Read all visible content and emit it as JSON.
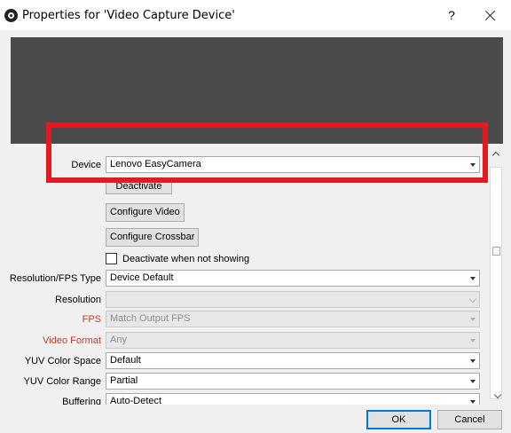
{
  "window": {
    "title": "Properties for 'Video Capture Device'",
    "help_label": "?"
  },
  "form": {
    "device": {
      "label": "Device",
      "value": "Lenovo EasyCamera"
    },
    "deactivate_label": "Deactivate",
    "configure_video_label": "Configure Video",
    "configure_crossbar_label": "Configure Crossbar",
    "deactivate_when_not_showing": {
      "label": "Deactivate when not showing",
      "checked": false
    },
    "resolution_fps_type": {
      "label": "Resolution/FPS Type",
      "value": "Device Default"
    },
    "resolution": {
      "label": "Resolution",
      "value": ""
    },
    "fps": {
      "label": "FPS",
      "value": "Match Output FPS"
    },
    "video_format": {
      "label": "Video Format",
      "value": "Any"
    },
    "yuv_color_space": {
      "label": "YUV Color Space",
      "value": "Default"
    },
    "yuv_color_range": {
      "label": "YUV Color Range",
      "value": "Partial"
    },
    "buffering": {
      "label": "Buffering",
      "value": "Auto-Detect"
    }
  },
  "footer": {
    "ok_label": "OK",
    "cancel_label": "Cancel"
  },
  "colors": {
    "highlight": "#e21b23",
    "required_label": "#c0392b",
    "preview_background": "#4a4a4a"
  }
}
